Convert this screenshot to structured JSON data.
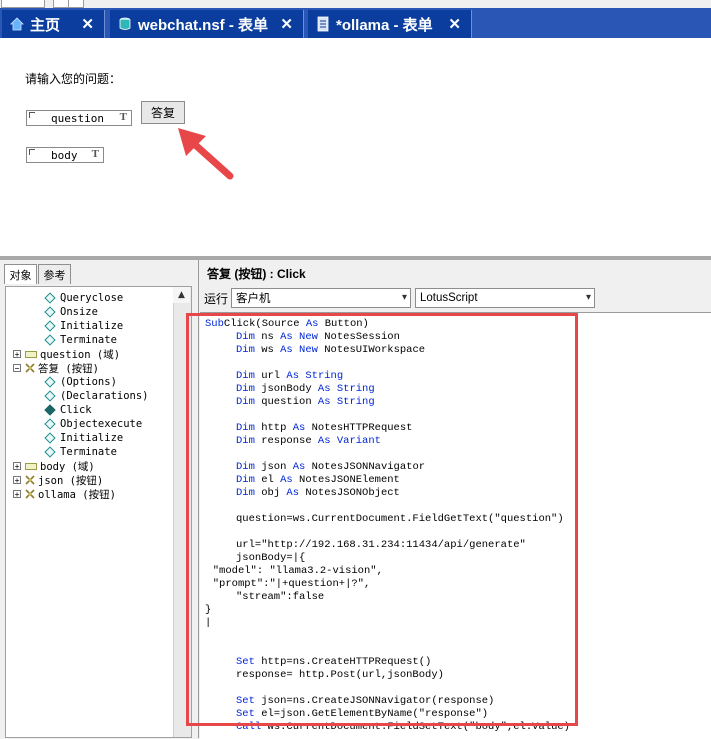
{
  "tabs": [
    {
      "label": "主页",
      "icon": "home-icon",
      "close": "✕"
    },
    {
      "label": "webchat.nsf - 表单",
      "icon": "database-icon",
      "close": "✕"
    },
    {
      "label": "*ollama - 表单",
      "icon": "form-icon",
      "close": "✕"
    }
  ],
  "form": {
    "prompt": "请输入您的问题：",
    "fields": [
      {
        "name": "question",
        "type": "T"
      },
      {
        "name": "body",
        "type": "T"
      }
    ],
    "button_label": "答复"
  },
  "left_tabs": [
    "对象",
    "参考"
  ],
  "tree": [
    {
      "label": "Queryclose",
      "kind": "event"
    },
    {
      "label": "Onsize",
      "kind": "event"
    },
    {
      "label": "Initialize",
      "kind": "event"
    },
    {
      "label": "Terminate",
      "kind": "event"
    },
    {
      "label": "question (域)",
      "kind": "field",
      "expander": "+"
    },
    {
      "label": "答复 (按钮)",
      "kind": "button",
      "expander": "−"
    },
    {
      "label": "(Options)",
      "kind": "event"
    },
    {
      "label": "(Declarations)",
      "kind": "event"
    },
    {
      "label": "Click",
      "kind": "event",
      "selected": true
    },
    {
      "label": "Objectexecute",
      "kind": "event"
    },
    {
      "label": "Initialize",
      "kind": "event"
    },
    {
      "label": "Terminate",
      "kind": "event"
    },
    {
      "label": "body (域)",
      "kind": "field",
      "expander": "+"
    },
    {
      "label": "json (按钮)",
      "kind": "button",
      "expander": "+"
    },
    {
      "label": "ollama (按钮)",
      "kind": "button",
      "expander": "+"
    }
  ],
  "editor": {
    "title": "答复 (按钮) : Click",
    "run_label": "运行",
    "run_target": "客户机",
    "language": "LotusScript",
    "code": [
      {
        "indent": 0,
        "parts": [
          [
            "kw",
            "Sub"
          ],
          [
            "",
            "Click(Source "
          ],
          [
            "kw",
            "As"
          ],
          [
            "",
            " Button)"
          ]
        ]
      },
      {
        "indent": 4,
        "parts": [
          [
            "kw",
            "Dim"
          ],
          [
            "",
            " ns "
          ],
          [
            "kw",
            "As"
          ],
          [
            "",
            " "
          ],
          [
            "kw",
            "New"
          ],
          [
            "",
            " NotesSession"
          ]
        ]
      },
      {
        "indent": 4,
        "parts": [
          [
            "kw",
            "Dim"
          ],
          [
            "",
            " ws "
          ],
          [
            "kw",
            "As"
          ],
          [
            "",
            " "
          ],
          [
            "kw",
            "New"
          ],
          [
            "",
            " NotesUIWorkspace"
          ]
        ]
      },
      {
        "indent": 0,
        "parts": []
      },
      {
        "indent": 4,
        "parts": [
          [
            "kw",
            "Dim"
          ],
          [
            "",
            " url "
          ],
          [
            "kw",
            "As"
          ],
          [
            "",
            " "
          ],
          [
            "kw",
            "String"
          ]
        ]
      },
      {
        "indent": 4,
        "parts": [
          [
            "kw",
            "Dim"
          ],
          [
            "",
            " jsonBody "
          ],
          [
            "kw",
            "As"
          ],
          [
            "",
            " "
          ],
          [
            "kw",
            "String"
          ]
        ]
      },
      {
        "indent": 4,
        "parts": [
          [
            "kw",
            "Dim"
          ],
          [
            "",
            " question "
          ],
          [
            "kw",
            "As"
          ],
          [
            "",
            " "
          ],
          [
            "kw",
            "String"
          ]
        ]
      },
      {
        "indent": 0,
        "parts": []
      },
      {
        "indent": 4,
        "parts": [
          [
            "kw",
            "Dim"
          ],
          [
            "",
            " http "
          ],
          [
            "kw",
            "As"
          ],
          [
            "",
            " NotesHTTPRequest"
          ]
        ]
      },
      {
        "indent": 4,
        "parts": [
          [
            "kw",
            "Dim"
          ],
          [
            "",
            " response "
          ],
          [
            "kw",
            "As"
          ],
          [
            "",
            " "
          ],
          [
            "kw",
            "Variant"
          ]
        ]
      },
      {
        "indent": 0,
        "parts": []
      },
      {
        "indent": 4,
        "parts": [
          [
            "kw",
            "Dim"
          ],
          [
            "",
            " json "
          ],
          [
            "kw",
            "As"
          ],
          [
            "",
            " NotesJSONNavigator"
          ]
        ]
      },
      {
        "indent": 4,
        "parts": [
          [
            "kw",
            "Dim"
          ],
          [
            "",
            " el "
          ],
          [
            "kw",
            "As"
          ],
          [
            "",
            " NotesJSONElement"
          ]
        ]
      },
      {
        "indent": 4,
        "parts": [
          [
            "kw",
            "Dim"
          ],
          [
            "",
            " obj "
          ],
          [
            "kw",
            "As"
          ],
          [
            "",
            " NotesJSONObject"
          ]
        ]
      },
      {
        "indent": 0,
        "parts": []
      },
      {
        "indent": 4,
        "parts": [
          [
            "",
            "question=ws.CurrentDocument.FieldGetText(\"question\")"
          ]
        ]
      },
      {
        "indent": 0,
        "parts": []
      },
      {
        "indent": 4,
        "parts": [
          [
            "",
            "url=\"http://192.168.31.234:11434/api/generate\""
          ]
        ]
      },
      {
        "indent": 4,
        "parts": [
          [
            "",
            "jsonBody=|{"
          ]
        ]
      },
      {
        "indent": 1,
        "parts": [
          [
            "",
            "\"model\": \"llama3.2-vision\","
          ]
        ]
      },
      {
        "indent": 1,
        "parts": [
          [
            "",
            "\"prompt\":\"|+question+|?\","
          ]
        ]
      },
      {
        "indent": 4,
        "parts": [
          [
            "",
            "\"stream\":false"
          ]
        ]
      },
      {
        "indent": 0,
        "parts": [
          [
            "",
            "}"
          ]
        ]
      },
      {
        "indent": 0,
        "parts": [
          [
            "",
            "|"
          ]
        ]
      },
      {
        "indent": 0,
        "parts": []
      },
      {
        "indent": 0,
        "parts": []
      },
      {
        "indent": 4,
        "parts": [
          [
            "kw",
            "Set"
          ],
          [
            "",
            " http=ns.CreateHTTPRequest()"
          ]
        ]
      },
      {
        "indent": 4,
        "parts": [
          [
            "",
            "response= http.Post(url,jsonBody)"
          ]
        ]
      },
      {
        "indent": 0,
        "parts": []
      },
      {
        "indent": 4,
        "parts": [
          [
            "kw",
            "Set"
          ],
          [
            "",
            " json=ns.CreateJSONNavigator(response)"
          ]
        ]
      },
      {
        "indent": 4,
        "parts": [
          [
            "kw",
            "Set"
          ],
          [
            "",
            " el=json.GetElementByName(\"response\")"
          ]
        ]
      },
      {
        "indent": 4,
        "parts": [
          [
            "kw",
            "Call"
          ],
          [
            "",
            " ws.CurrentDocument.FieldSetText(\"body\",el.Value)"
          ]
        ]
      }
    ]
  },
  "colors": {
    "tabbar": "#2a57b5",
    "active_tab": "#0a3d9e",
    "keyword": "#0026d6",
    "highlight": "#e8474a"
  }
}
